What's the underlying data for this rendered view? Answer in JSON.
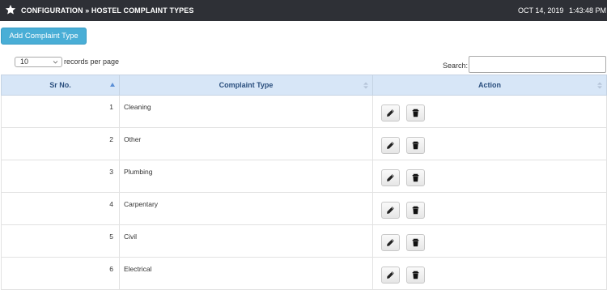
{
  "header": {
    "title": "CONFIGURATION » HOSTEL COMPLAINT TYPES",
    "date": "OCT 14, 2019",
    "time": "1:43:48 PM",
    "icon": "star-icon"
  },
  "toolbar": {
    "add_label": "Add Complaint Type"
  },
  "length": {
    "selected": "10",
    "label": "records per page"
  },
  "search": {
    "label": "Search:",
    "value": ""
  },
  "table": {
    "columns": [
      "Sr No.",
      "Complaint Type",
      "Action"
    ],
    "rows": [
      {
        "sr": "1",
        "type": "Cleaning"
      },
      {
        "sr": "2",
        "type": "Other"
      },
      {
        "sr": "3",
        "type": "Plumbing"
      },
      {
        "sr": "4",
        "type": "Carpentary"
      },
      {
        "sr": "5",
        "type": "Civil"
      },
      {
        "sr": "6",
        "type": "Electrical"
      }
    ],
    "actions": [
      "pencil-icon",
      "trash-icon"
    ]
  },
  "colors": {
    "topbar": "#2e3036",
    "add_button": "#49aed6",
    "header_bg": "#d7e6f7",
    "header_text": "#2b4f7e"
  }
}
